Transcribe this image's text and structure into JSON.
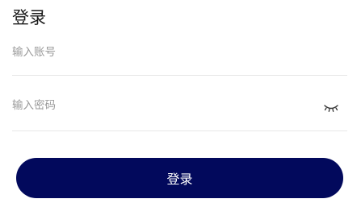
{
  "page": {
    "title": "登录"
  },
  "form": {
    "account_placeholder": "输入账号",
    "password_placeholder": "输入密码",
    "password_toggle_icon": "eye-closed-icon",
    "submit_label": "登录"
  },
  "colors": {
    "primary_button": "#02095c",
    "divider": "#e6e6e6",
    "placeholder": "#9a9a9a"
  }
}
